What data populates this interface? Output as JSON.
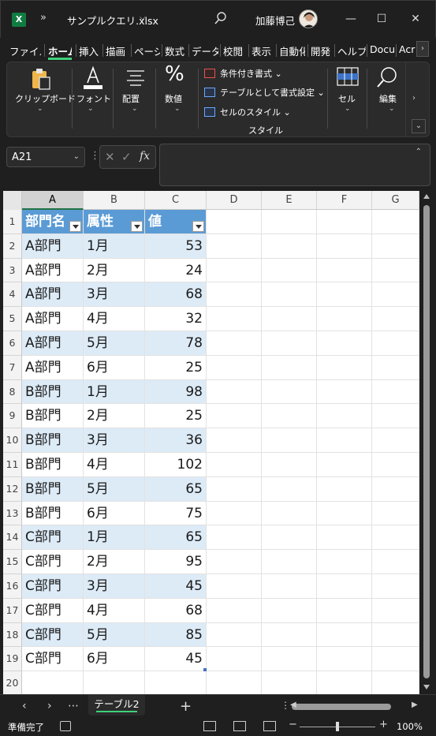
{
  "window": {
    "filename": "サンプルクエリ.xlsx",
    "user_name": "加藤博己",
    "overflow_glyph": "»",
    "minimize": "—",
    "maximize": "☐",
    "close": "✕"
  },
  "menu_tabs": [
    "ファイル",
    "ホーム",
    "挿入",
    "描画",
    "ページ",
    "数式",
    "データ",
    "校閲",
    "表示",
    "自動化",
    "開発",
    "ヘルプ",
    "Docu",
    "Acr"
  ],
  "ribbon": {
    "clipboard": "クリップボード",
    "font": "フォント",
    "alignment": "配置",
    "number": "数値",
    "conditional_formatting": "条件付き書式",
    "format_as_table": "テーブルとして書式設定",
    "cell_styles": "セルのスタイル",
    "styles_group": "スタイル",
    "cells": "セル",
    "editing": "編集"
  },
  "formula_bar": {
    "name_box": "A21",
    "fx": "fx",
    "formula": ""
  },
  "columns": [
    "A",
    "B",
    "C",
    "D",
    "E",
    "F",
    "G"
  ],
  "selected_column": "A",
  "table": {
    "headers": [
      "部門名",
      "属性",
      "値"
    ],
    "rows": [
      [
        "A部門",
        "1月",
        "53"
      ],
      [
        "A部門",
        "2月",
        "24"
      ],
      [
        "A部門",
        "3月",
        "68"
      ],
      [
        "A部門",
        "4月",
        "32"
      ],
      [
        "A部門",
        "5月",
        "78"
      ],
      [
        "A部門",
        "6月",
        "25"
      ],
      [
        "B部門",
        "1月",
        "98"
      ],
      [
        "B部門",
        "2月",
        "25"
      ],
      [
        "B部門",
        "3月",
        "36"
      ],
      [
        "B部門",
        "4月",
        "102"
      ],
      [
        "B部門",
        "5月",
        "65"
      ],
      [
        "B部門",
        "6月",
        "75"
      ],
      [
        "C部門",
        "1月",
        "65"
      ],
      [
        "C部門",
        "2月",
        "95"
      ],
      [
        "C部門",
        "3月",
        "45"
      ],
      [
        "C部門",
        "4月",
        "68"
      ],
      [
        "C部門",
        "5月",
        "85"
      ],
      [
        "C部門",
        "6月",
        "45"
      ]
    ]
  },
  "row_numbers": [
    "1",
    "2",
    "3",
    "4",
    "5",
    "6",
    "7",
    "8",
    "9",
    "10",
    "11",
    "12",
    "13",
    "14",
    "15",
    "16",
    "17",
    "18",
    "19",
    "20"
  ],
  "sheet_tabs": {
    "prev": "‹",
    "next": "›",
    "more": "⋯",
    "active": "テーブル2",
    "add": "+"
  },
  "status": {
    "ready": "準備完了",
    "zoom_minus": "−",
    "zoom_plus": "+",
    "zoom": "100%"
  },
  "colors": {
    "accent_green": "#3fd07a",
    "table_header": "#5b9bd5",
    "table_band": "#ddebf7"
  }
}
